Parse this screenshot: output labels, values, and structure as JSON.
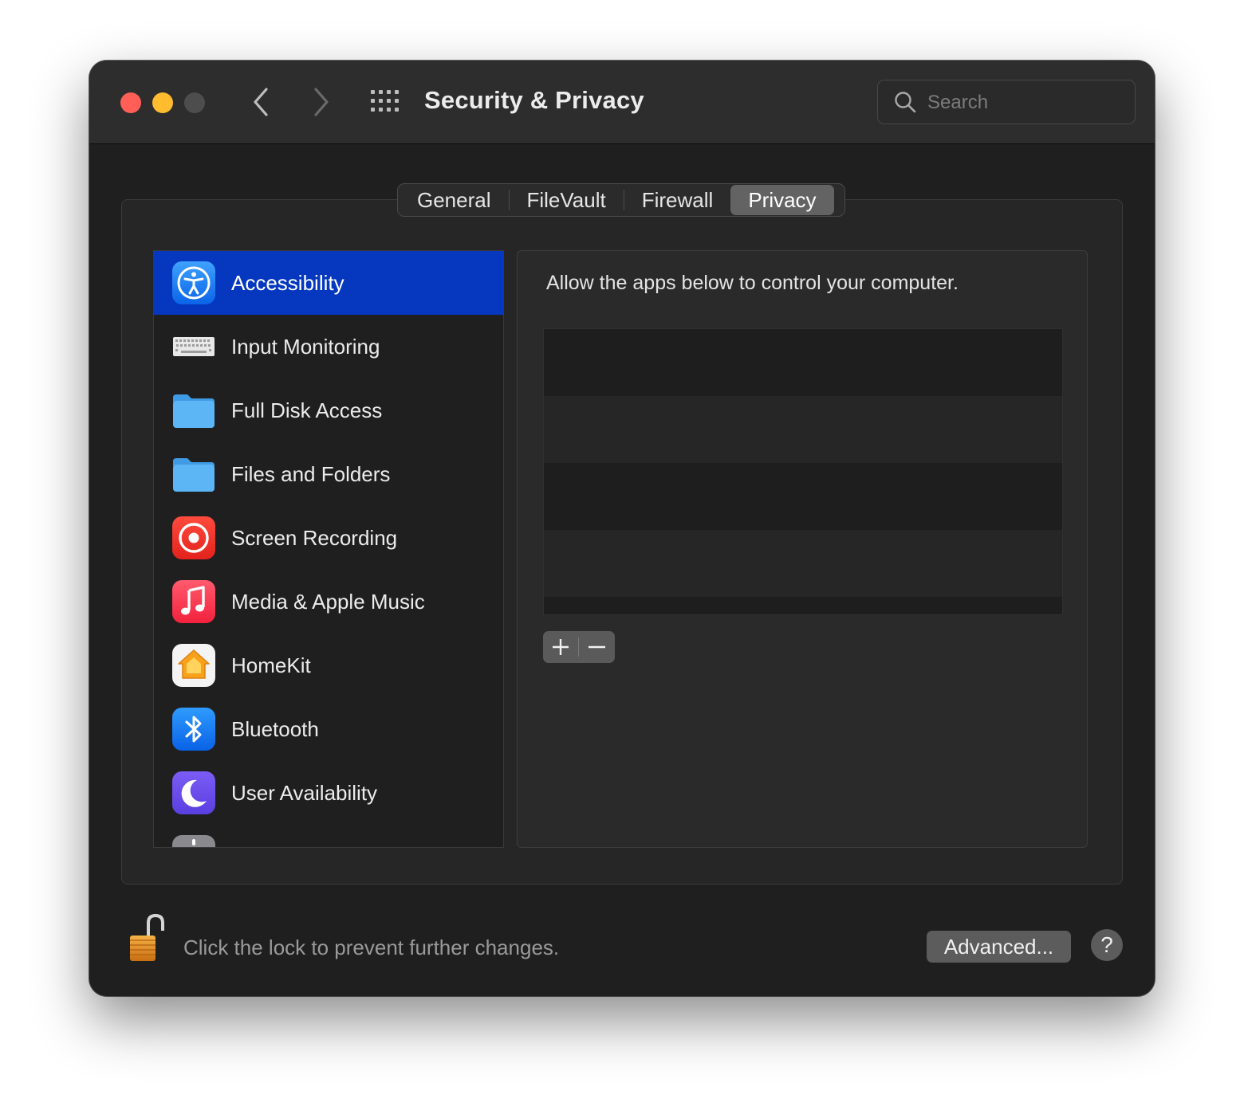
{
  "window": {
    "title": "Security & Privacy",
    "search_placeholder": "Search"
  },
  "icons": {
    "back": "chevron-left-icon",
    "forward": "chevron-right-icon",
    "show_all": "grid-icon",
    "search": "magnifier-icon"
  },
  "tabs": [
    {
      "label": "General",
      "active": false
    },
    {
      "label": "FileVault",
      "active": false
    },
    {
      "label": "Firewall",
      "active": false
    },
    {
      "label": "Privacy",
      "active": true
    }
  ],
  "sidebar": {
    "items": [
      {
        "label": "Accessibility",
        "icon": "accessibility-icon",
        "selected": true
      },
      {
        "label": "Input Monitoring",
        "icon": "keyboard-icon",
        "selected": false
      },
      {
        "label": "Full Disk Access",
        "icon": "folder-icon",
        "selected": false
      },
      {
        "label": "Files and Folders",
        "icon": "folder-icon",
        "selected": false
      },
      {
        "label": "Screen Recording",
        "icon": "screen-recording-icon",
        "selected": false
      },
      {
        "label": "Media & Apple Music",
        "icon": "music-icon",
        "selected": false
      },
      {
        "label": "HomeKit",
        "icon": "home-icon",
        "selected": false
      },
      {
        "label": "Bluetooth",
        "icon": "bluetooth-icon",
        "selected": false
      },
      {
        "label": "User Availability",
        "icon": "moon-icon",
        "selected": false
      }
    ]
  },
  "content": {
    "description": "Allow the apps below to control your computer.",
    "add_symbol": "+",
    "remove_symbol": "−"
  },
  "footer": {
    "lock_text": "Click the lock to prevent further changes.",
    "advanced_label": "Advanced...",
    "help_label": "?"
  },
  "colors": {
    "selection": "#0538be",
    "close": "#ff5f57",
    "minimize": "#febc2e",
    "zoom_disabled": "#4d4d4d"
  }
}
